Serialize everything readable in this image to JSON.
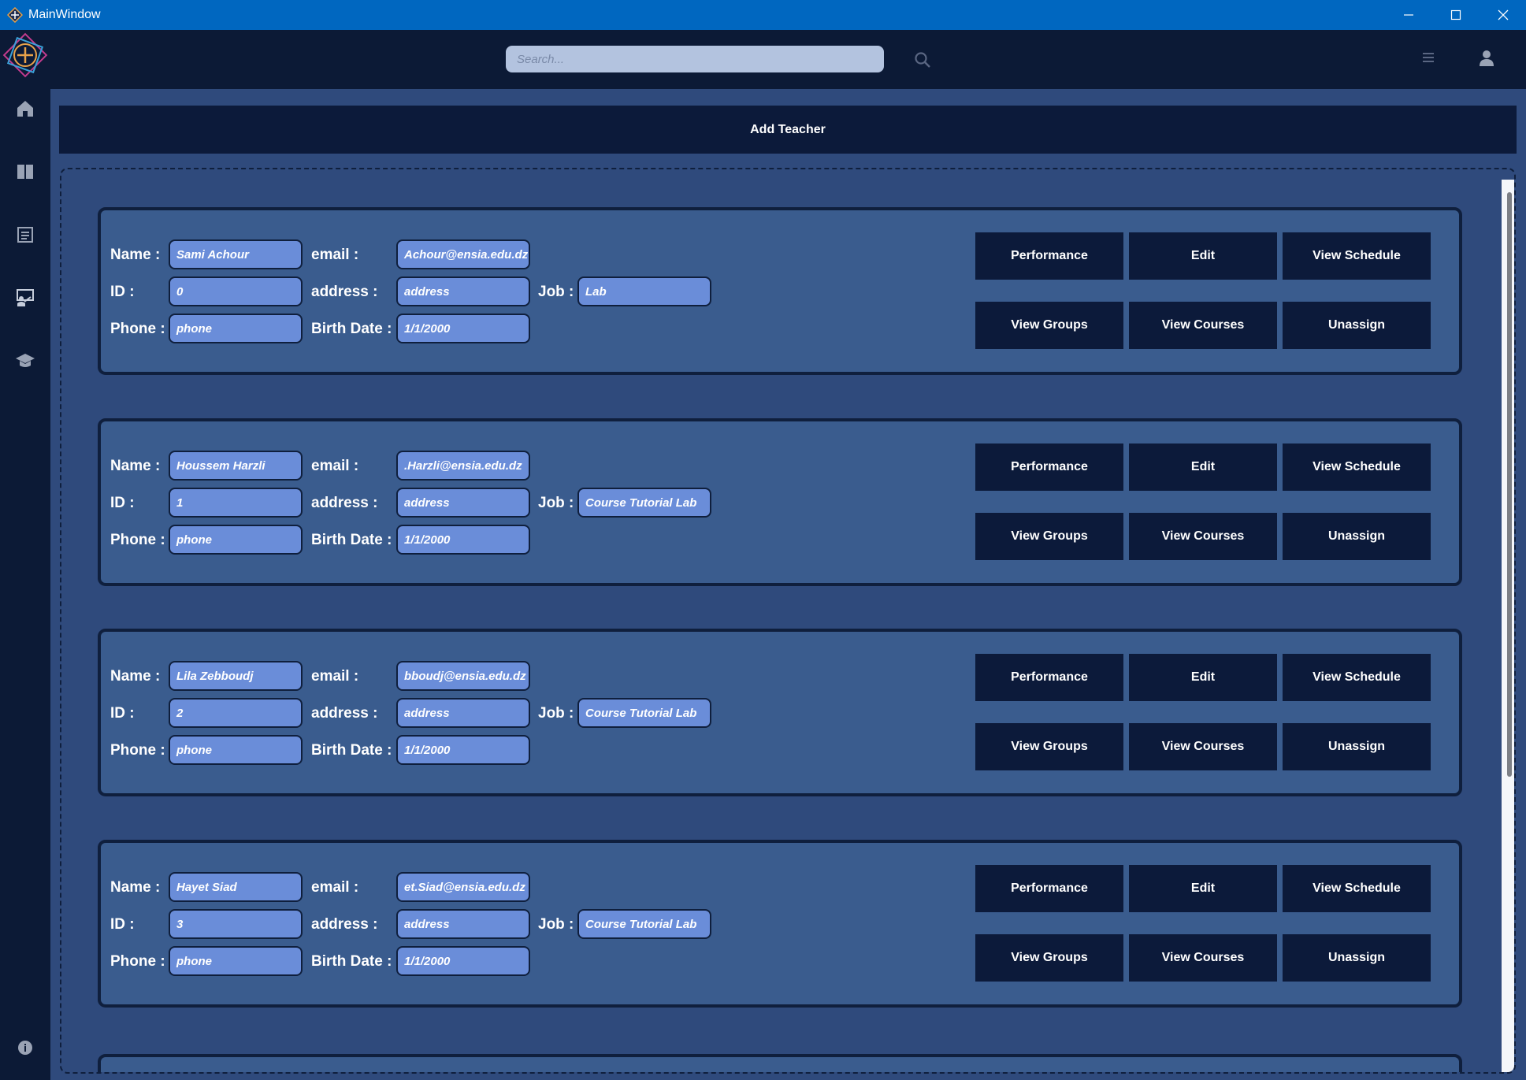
{
  "window": {
    "title": "MainWindow"
  },
  "search": {
    "placeholder": "Search..."
  },
  "main": {
    "add_teacher_label": "Add Teacher"
  },
  "labels": {
    "name": "Name :",
    "email": "email :",
    "id": "ID :",
    "address": "address :",
    "job": "Job :",
    "phone": "Phone :",
    "birth_date": "Birth Date :"
  },
  "actions": {
    "performance": "Performance",
    "edit": "Edit",
    "view_schedule": "View Schedule",
    "view_groups": "View Groups",
    "view_courses": "View Courses",
    "unassign": "Unassign"
  },
  "teachers": [
    {
      "name": "Sami Achour",
      "email": "Achour@ensia.edu.dz",
      "id": "0",
      "address": "address",
      "job": "Lab",
      "phone": "phone",
      "birth_date": "1/1/2000"
    },
    {
      "name": "Houssem Harzli",
      "email": ".Harzli@ensia.edu.dz",
      "id": "1",
      "address": "address",
      "job": "Course Tutorial Lab",
      "phone": "phone",
      "birth_date": "1/1/2000"
    },
    {
      "name": "Lila Zebboudj",
      "email": "bboudj@ensia.edu.dz",
      "id": "2",
      "address": "address",
      "job": "Course Tutorial Lab",
      "phone": "phone",
      "birth_date": "1/1/2000"
    },
    {
      "name": "Hayet Siad",
      "email": "et.Siad@ensia.edu.dz",
      "id": "3",
      "address": "address",
      "job": "Course Tutorial Lab",
      "phone": "phone",
      "birth_date": "1/1/2000"
    }
  ],
  "sidebar": {
    "items": [
      {
        "icon": "home-icon"
      },
      {
        "icon": "book-icon"
      },
      {
        "icon": "list-icon"
      },
      {
        "icon": "teacher-icon"
      },
      {
        "icon": "graduation-cap-icon"
      }
    ],
    "footer_icon": "info-icon"
  },
  "colors": {
    "titlebar": "#0067c0",
    "sidebar": "#0c1a36",
    "main": "#2f4a7c",
    "card": "#3a5c8e",
    "field": "#6a8dd9",
    "button": "#0c1a3a"
  }
}
